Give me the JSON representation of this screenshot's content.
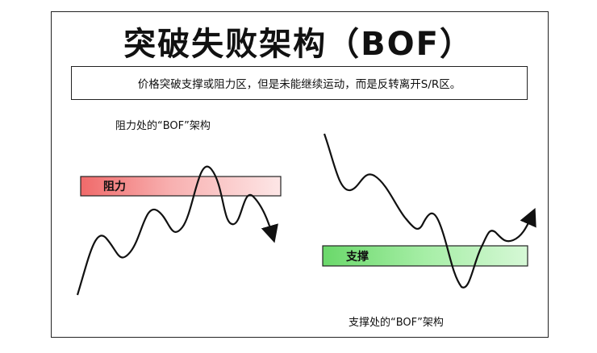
{
  "title": "突破失败架构（BOF）",
  "definition": "价格突破支撑或阻力区，但是未能继续运动，而是反转离开S/R区。",
  "left_panel": {
    "caption": "阻力处的“BOF”架构",
    "zone_label": "阻力",
    "zone_color": "#f07878"
  },
  "right_panel": {
    "caption": "支撑处的“BOF”架构",
    "zone_label": "支撑",
    "zone_color": "#7ee07e"
  }
}
